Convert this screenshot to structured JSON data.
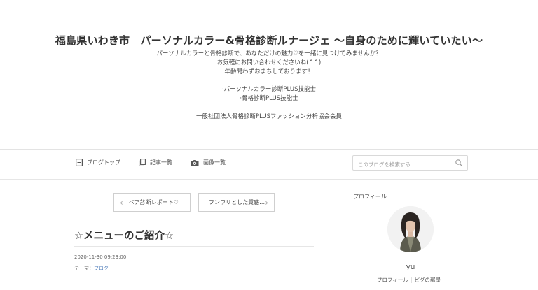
{
  "header": {
    "title": "福島県いわき市　パーソナルカラー&骨格診断ルナージェ 〜自身のために輝いていたい〜",
    "description": [
      "パーソナルカラーと骨格診断で、あなただけの魅力♡を一緒に見つけてみませんか？",
      "お気軽にお問い合わせくださいね(^^)",
      "年齢問わずおまちしております！",
      "",
      "·パーソナルカラー診断PLUS技能士",
      "·骨格診断PLUS技能士",
      "",
      "一般社団法人骨格診断PLUSファッション分析協会会員"
    ]
  },
  "nav": {
    "blog_top": "ブログトップ",
    "articles": "記事一覧",
    "images": "画像一覧",
    "search_placeholder": "このブログを検索する"
  },
  "pager": {
    "prev_label": "ペア診断レポート♡",
    "next_label": "フンワリとした質感…"
  },
  "entry": {
    "title": "☆メニューのご紹介☆",
    "date": "2020-11-30 09:23:00",
    "theme_label": "テーマ：",
    "theme_value": "ブログ"
  },
  "profile": {
    "heading": "プロフィール",
    "name": "yu",
    "link_profile": "プロフィール",
    "link_separator": "|",
    "link_room": "ピグの部屋"
  },
  "colors": {
    "link": "#4a7ab8",
    "border": "#d9d9d9"
  }
}
